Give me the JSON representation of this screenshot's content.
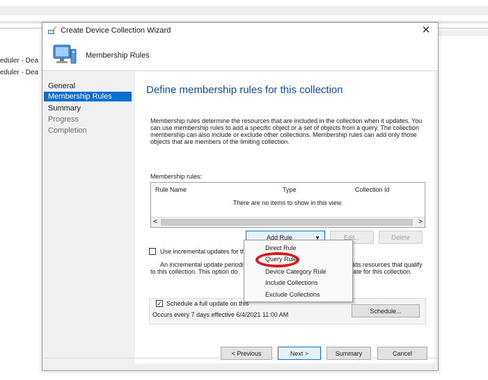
{
  "background": {
    "row1": "eduler - Dea",
    "row2": "eduler - Dea"
  },
  "window": {
    "title": "Create Device Collection Wizard",
    "close_glyph": "✕"
  },
  "header": {
    "title": "Membership Rules"
  },
  "nav": {
    "items": [
      {
        "label": "General"
      },
      {
        "label": "Membership Rules"
      },
      {
        "label": "Summary"
      },
      {
        "label": "Progress"
      },
      {
        "label": "Completion"
      }
    ]
  },
  "content": {
    "title": "Define membership rules for this collection",
    "description": "Membership rules determine the resources that are included in the collection when it updates. You can use membership rules to add a specific object or a set of objects from a query. The collection membership can also include or exclude other collections. Membership rules can add only those objects that are members of the limiting collection.",
    "rules_label": "Membership rules:",
    "columns": [
      "Rule Name",
      "Type",
      "Collection Id"
    ],
    "empty_text": "There are no items to show in this view.",
    "scroll_left": "<",
    "scroll_right": ">",
    "add_rule": "Add Rule",
    "edit": "Edit...",
    "delete": "Delete",
    "incremental_label": "Use incremental updates for this",
    "incremental_desc_1_left": "An incremental update periodic",
    "incremental_desc_1_right": "adds resources that qualify",
    "incremental_desc_2_left": "to this collection. This option do",
    "incremental_desc_2_right": "date for this collection.",
    "schedule_label": "Schedule a full update on this",
    "schedule_checked": "✓",
    "schedule_occurs": "Occurs every 7 days effective 6/4/2021 11:00 AM",
    "schedule_button": "Schedule..."
  },
  "add_rule_menu": {
    "items": [
      {
        "label": "Direct Rule"
      },
      {
        "label": "Query Rule"
      },
      {
        "label": "Device Category Rule"
      },
      {
        "label": "Include Collections"
      },
      {
        "label": "Exclude Collections"
      }
    ]
  },
  "footer": {
    "previous": "< Previous",
    "next": "Next >",
    "summary": "Summary",
    "cancel": "Cancel"
  },
  "colors": {
    "accent": "#0a6ed1",
    "title_blue": "#0f4fa8",
    "highlight_circle": "#e3131a"
  }
}
